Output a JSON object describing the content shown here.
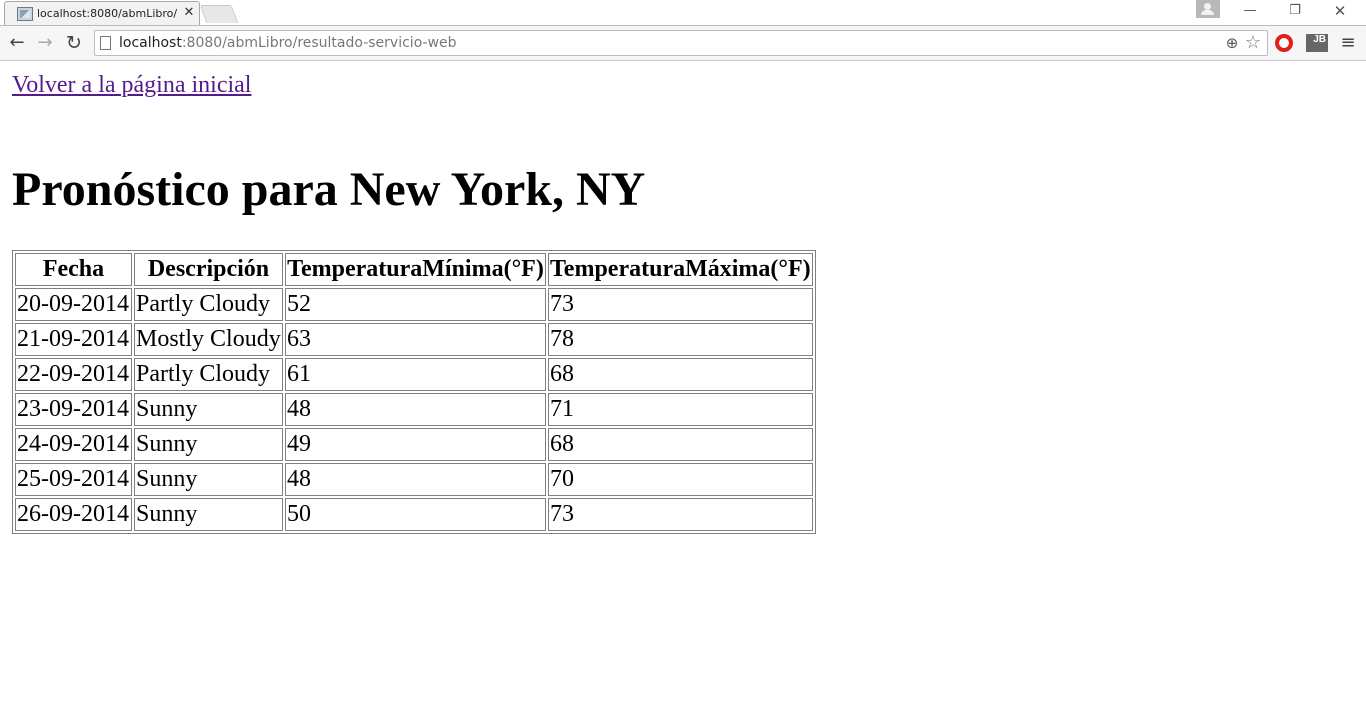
{
  "browser": {
    "tab_title": "localhost:8080/abmLibro/",
    "tab_close": "✕",
    "url_host": "localhost",
    "url_rest": ":8080/abmLibro/resultado-servicio-web",
    "window_min": "—",
    "window_max": "❐",
    "window_close": "✕",
    "extension_jb": "JB",
    "accent_opera": "#e0201b"
  },
  "page": {
    "back_link": "Volver a la página inicial",
    "link_color": "#551a8b",
    "title": "Pronóstico para New York, NY",
    "table": {
      "headers": [
        "Fecha",
        "Descripción",
        "TemperaturaMínima(°F)",
        "TemperaturaMáxima(°F)"
      ],
      "rows": [
        [
          "20-09-2014",
          "Partly Cloudy",
          "52",
          "73"
        ],
        [
          "21-09-2014",
          "Mostly Cloudy",
          "63",
          "78"
        ],
        [
          "22-09-2014",
          "Partly Cloudy",
          "61",
          "68"
        ],
        [
          "23-09-2014",
          "Sunny",
          "48",
          "71"
        ],
        [
          "24-09-2014",
          "Sunny",
          "49",
          "68"
        ],
        [
          "25-09-2014",
          "Sunny",
          "48",
          "70"
        ],
        [
          "26-09-2014",
          "Sunny",
          "50",
          "73"
        ]
      ]
    }
  }
}
